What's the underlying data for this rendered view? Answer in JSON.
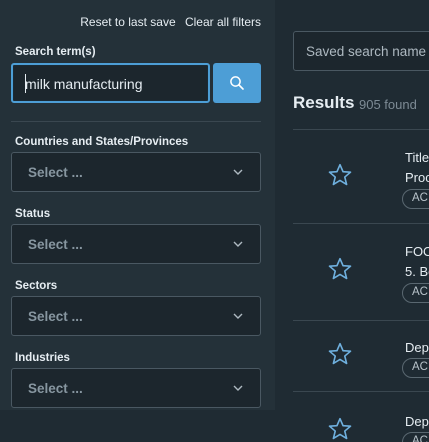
{
  "filters": {
    "reset_label": "Reset to last save",
    "clear_label": "Clear all filters",
    "search_label": "Search term(s)",
    "search_value": "milk manufacturing",
    "search_icon": "search-icon",
    "selects": [
      {
        "label": "Countries and States/Provinces",
        "placeholder": "Select ..."
      },
      {
        "label": "Status",
        "placeholder": "Select ..."
      },
      {
        "label": "Sectors",
        "placeholder": "Select ..."
      },
      {
        "label": "Industries",
        "placeholder": "Select ..."
      }
    ]
  },
  "saved_search": {
    "placeholder": "Saved search name"
  },
  "results": {
    "title": "Results",
    "count": "905 found",
    "rows": [
      {
        "line1": "Title",
        "line2": "Proc",
        "badge": "AC"
      },
      {
        "line1": "FOO",
        "line2": "5. Bo",
        "badge": "AC"
      },
      {
        "line1": "Dep",
        "line2": "",
        "badge": "AC"
      },
      {
        "line1": "Dep",
        "line2": "",
        "badge": "AC"
      }
    ]
  },
  "colors": {
    "accent": "#4d9ed6",
    "panel": "#243139",
    "background": "#1f2b33"
  }
}
